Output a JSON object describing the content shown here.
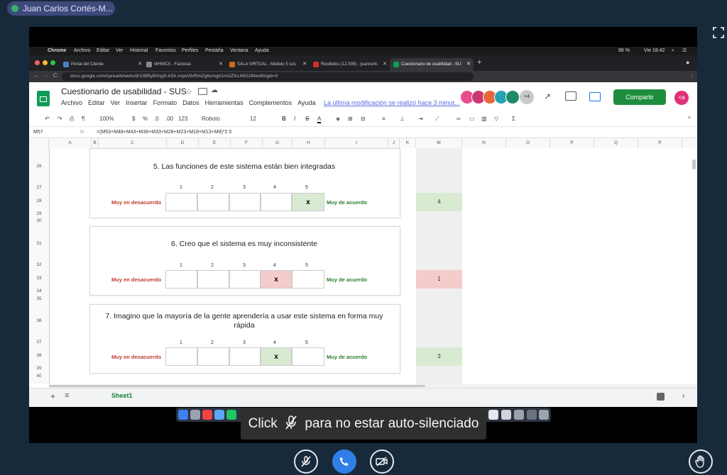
{
  "participant": {
    "name": "Juan Carlos Cortés-M..."
  },
  "mac_bar": {
    "app": "Chrome",
    "menus": [
      "Archivo",
      "Editar",
      "Ver",
      "Historial",
      "Favoritos",
      "Perfiles",
      "Pestaña",
      "Ventana",
      "Ayuda"
    ],
    "battery": "96 %",
    "clock": "Vie 18:42"
  },
  "browser": {
    "tabs": [
      {
        "title": "Portal del Cliente",
        "fav_color": "#4b83c6"
      },
      {
        "title": "WHMCS - Facturas",
        "fav_color": "#888888"
      },
      {
        "title": "SALA VIRTUAL - Módulo 5 sus",
        "fav_color": "#d2691e"
      },
      {
        "title": "Recibidos (12.509) - juancortc",
        "fav_color": "#d93025"
      },
      {
        "title": "Cuestionario de usabilidad - SU",
        "fav_color": "#0f9d58"
      }
    ],
    "url": "docs.google.com/spreadsheets/d/1I9tRyBVrpjS-kSh.zxpsVbrRmZgbumgh1mOZfcLMIG2M/edit#gid=0"
  },
  "sheet": {
    "title": "Cuestionario de usabilidad - SUS",
    "menus": [
      "Archivo",
      "Editar",
      "Ver",
      "Insertar",
      "Formato",
      "Datos",
      "Herramientas",
      "Complementos",
      "Ayuda"
    ],
    "last_modified": "La última modificación se realizó hace 3 minut...",
    "share_label": "Compartir",
    "extra_users": "+4",
    "user_initial": "<a",
    "toolbar": {
      "zoom": "100%",
      "currency": "$",
      "percent": "%",
      "dec0": ".0",
      "dec00": ".00",
      "format": "123",
      "font": "Roboto",
      "size": "12",
      "bold": "B",
      "italic": "I",
      "strike": "S",
      "color": "A",
      "sum": "Σ"
    },
    "cell_ref": "M57",
    "fx": "fx",
    "formula": "=(M53+M48+M43+M38+M33+M28+M23+M18+M13+M8)*2.5",
    "columns": [
      "A",
      "B",
      "C",
      "D",
      "E",
      "F",
      "G",
      "H",
      "I",
      "J",
      "K",
      "M",
      "N",
      "O",
      "P",
      "Q",
      "R"
    ],
    "rows": [
      "26",
      "27",
      "28",
      "29",
      "30",
      "31",
      "32",
      "33",
      "34",
      "35",
      "36",
      "37",
      "38",
      "39",
      "40"
    ],
    "scale_numbers": [
      "1",
      "2",
      "3",
      "4",
      "5"
    ],
    "label_disagree": "Muy en desacuerdo",
    "label_agree": "Muy de acuerdo",
    "questions": [
      {
        "text": "5. Las funciones de este sistema están bien integradas",
        "selected": 5,
        "mark": "x",
        "score": "4",
        "color": "#d9ead3"
      },
      {
        "text": "6. Creo que el sistema es muy inconsistente",
        "selected": 4,
        "mark": "x",
        "score": "1",
        "color": "#f4cccc"
      },
      {
        "text": "7. Imagino que la mayoría de la gente aprendería a usar este sistema en forma muy rápida",
        "selected": 4,
        "mark": "x",
        "score": "3",
        "color": "#d9ead3"
      }
    ],
    "sheet_tab": "Sheet1"
  },
  "toast": {
    "before": "Click",
    "after": "para no estar auto-silenciado"
  }
}
